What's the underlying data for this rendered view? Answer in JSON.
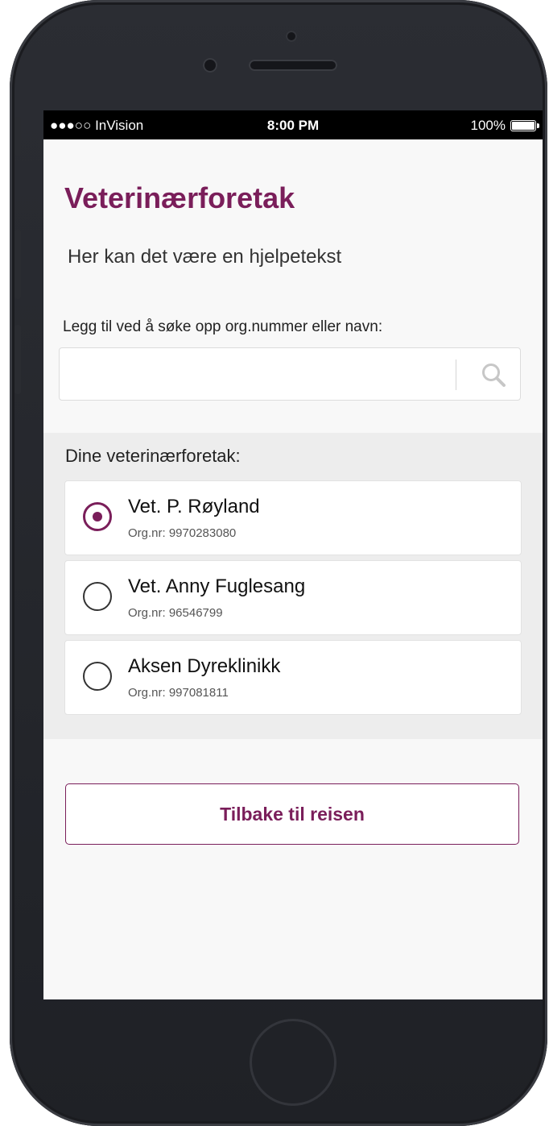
{
  "status_bar": {
    "carrier": "●●●○○ InVision",
    "time": "8:00 PM",
    "battery": "100%"
  },
  "page": {
    "title": "Veterinærforetak",
    "help_text": "Her kan det være en hjelpetekst"
  },
  "search": {
    "label": "Legg til ved å søke opp org.nummer eller navn:",
    "value": "",
    "placeholder": "",
    "icon": "search-icon"
  },
  "list": {
    "heading": "Dine veterinærforetak:",
    "items": [
      {
        "name": "Vet. P. Røyland",
        "org": "Org.nr: 9970283080",
        "selected": true
      },
      {
        "name": "Vet. Anny Fuglesang",
        "org": "Org.nr: 96546799",
        "selected": false
      },
      {
        "name": "Aksen Dyreklinikk",
        "org": "Org.nr: 997081811",
        "selected": false
      }
    ]
  },
  "actions": {
    "back_label": "Tilbake til reisen"
  },
  "colors": {
    "accent": "#7a1e5a",
    "screen_bg": "#f8f8f8",
    "list_bg": "#ededed"
  }
}
